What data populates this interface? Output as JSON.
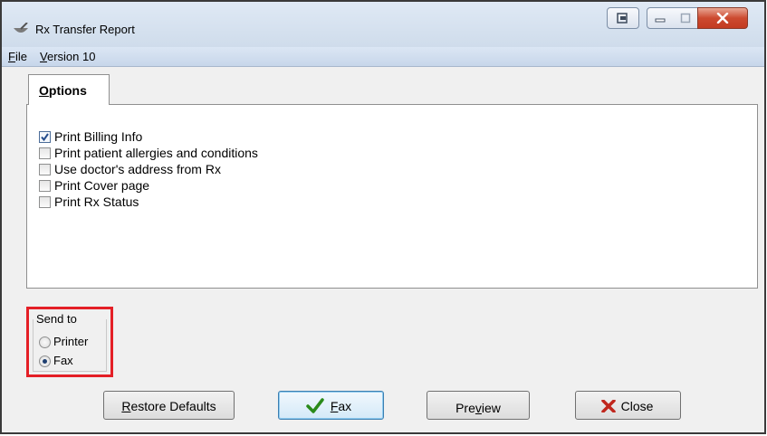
{
  "window": {
    "title": "Rx Transfer Report"
  },
  "menu": {
    "file": {
      "underlined": "F",
      "rest": "ile"
    },
    "version": {
      "underlined": "V",
      "rest": "ersion 10"
    }
  },
  "tabs": {
    "options": {
      "underlined": "O",
      "rest": "ptions"
    }
  },
  "options": [
    {
      "label": "Print Billing Info",
      "checked": true
    },
    {
      "label": "Print patient allergies and conditions",
      "checked": false
    },
    {
      "label": "Use doctor's address from Rx",
      "checked": false
    },
    {
      "label": "Print Cover page",
      "checked": false
    },
    {
      "label": "Print Rx Status",
      "checked": false
    }
  ],
  "send_to": {
    "legend": "Send to",
    "printer": "Printer",
    "fax": "Fax",
    "selected": "Fax"
  },
  "buttons": {
    "restore": {
      "underlined": "R",
      "rest": "estore Defaults"
    },
    "fax": {
      "underlined": "F",
      "rest": "ax"
    },
    "preview": {
      "before": "Pre",
      "underlined": "v",
      "after": "iew"
    },
    "close": {
      "label": "Close"
    }
  },
  "colors": {
    "highlight_border": "#e41f26",
    "fax_check": "#2a8a1a",
    "close_x": "#c0261d"
  }
}
